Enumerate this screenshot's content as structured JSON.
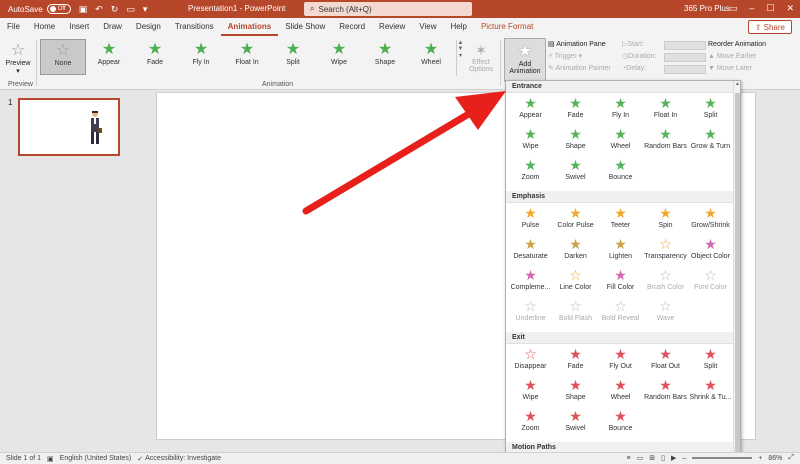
{
  "titlebar": {
    "autosave_label": "AutoSave",
    "autosave_state": "Off",
    "doc_title": "Presentation1  -  PowerPoint",
    "search_placeholder": "Search (Alt+Q)",
    "account": "365 Pro Plus"
  },
  "menu": {
    "tabs": [
      "File",
      "Home",
      "Insert",
      "Draw",
      "Design",
      "Transitions",
      "Animations",
      "Slide Show",
      "Record",
      "Review",
      "View",
      "Help",
      "Picture Format"
    ],
    "active": "Animations",
    "share": "Share"
  },
  "ribbon": {
    "preview_label": "Preview",
    "preview_group": "Preview",
    "animation_group": "Animation",
    "gallery": [
      "None",
      "Appear",
      "Fade",
      "Fly In",
      "Float In",
      "Split",
      "Wipe",
      "Shape",
      "Wheel"
    ],
    "effect_options": "Effect Options",
    "add_animation": "Add Animation",
    "advanced": {
      "animation_pane": "Animation Pane",
      "trigger": "Trigger",
      "animation_painter": "Animation Painter"
    },
    "timing": {
      "start": "Start:",
      "duration": "Duration:",
      "delay": "Delay:"
    },
    "reorder": {
      "title": "Reorder Animation",
      "earlier": "Move Earlier",
      "later": "Move Later"
    }
  },
  "slides_pane": {
    "slide_number": "1"
  },
  "dropdown": {
    "entrance": {
      "title": "Entrance",
      "items": [
        "Appear",
        "Fade",
        "Fly In",
        "Float In",
        "Split",
        "Wipe",
        "Shape",
        "Wheel",
        "Random Bars",
        "Grow & Turn",
        "Zoom",
        "Swivel",
        "Bounce"
      ]
    },
    "emphasis": {
      "title": "Emphasis",
      "items": [
        "Pulse",
        "Color Pulse",
        "Teeter",
        "Spin",
        "Grow/Shrink",
        "Desaturate",
        "Darken",
        "Lighten",
        "Transparency",
        "Object Color",
        "Compleme...",
        "Line Color",
        "Fill Color",
        "Brush Color",
        "Font Color",
        "Underline",
        "Bold Flash",
        "Bold Reveal",
        "Wave"
      ]
    },
    "exit": {
      "title": "Exit",
      "items": [
        "Disappear",
        "Fade",
        "Fly Out",
        "Float Out",
        "Split",
        "Wipe",
        "Shape",
        "Wheel",
        "Random Bars",
        "Shrink & Tu...",
        "Zoom",
        "Swivel",
        "Bounce"
      ]
    },
    "motion_paths": {
      "title": "Motion Paths"
    }
  },
  "statusbar": {
    "slide_info": "Slide 1 of 1",
    "language": "English (United States)",
    "accessibility": "Accessibility: Investigate",
    "zoom": "86%"
  },
  "colors": {
    "accent": "#b7472a",
    "arrow": "#e8201c"
  }
}
